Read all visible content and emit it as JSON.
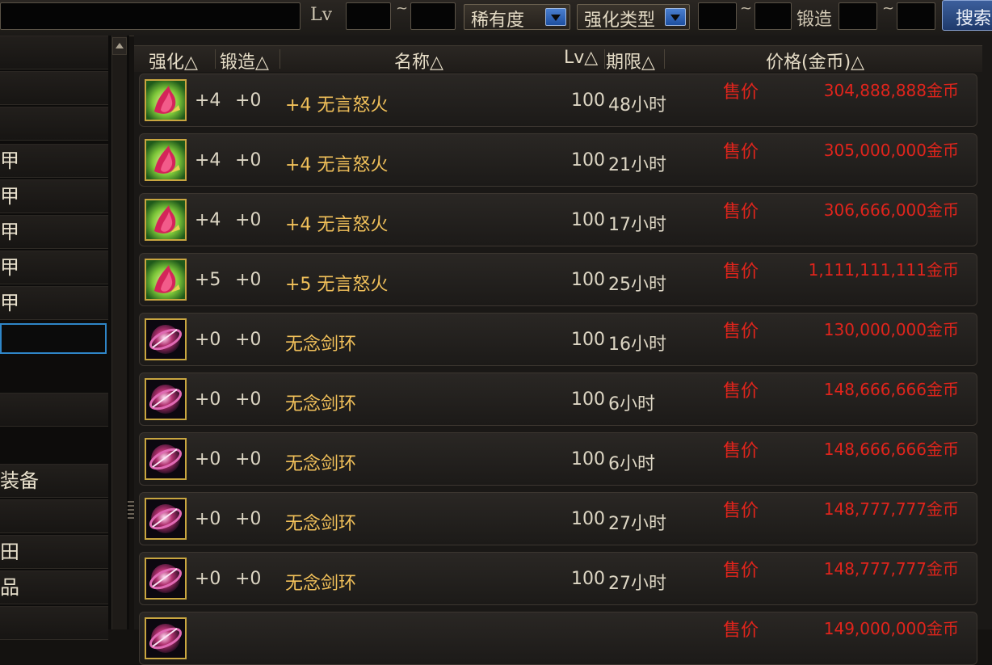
{
  "topbar": {
    "lv_label": "Lv",
    "tilde": "~",
    "rarity_label": "稀有度",
    "enhance_type_label": "强化类型",
    "forge_label": "锻造",
    "search_label": "搜索"
  },
  "sidebar": {
    "items": [
      {
        "label": ""
      },
      {
        "label": ""
      },
      {
        "label": ""
      },
      {
        "label": "甲"
      },
      {
        "label": "甲"
      },
      {
        "label": "甲"
      },
      {
        "label": "甲"
      },
      {
        "label": "甲"
      },
      {
        "label": ""
      },
      {
        "label": ""
      },
      {
        "label": ""
      },
      {
        "label": ""
      },
      {
        "label": "装备"
      },
      {
        "label": ""
      },
      {
        "label": "田"
      },
      {
        "label": "品"
      },
      {
        "label": ""
      }
    ]
  },
  "table": {
    "headers": {
      "enhance": "强化△",
      "forge": "锻造△",
      "name": "名称△",
      "lv": "Lv△",
      "expire": "期限△",
      "price": "价格(金币)△"
    },
    "sale_label": "售价",
    "rows": [
      {
        "icon": "flame-gem-icon",
        "enhance": "+4",
        "forge": "+0",
        "name": "+4 无言怒火",
        "lv": "100",
        "expire": "48小时",
        "price": "304,888,888金币"
      },
      {
        "icon": "flame-gem-icon",
        "enhance": "+4",
        "forge": "+0",
        "name": "+4 无言怒火",
        "lv": "100",
        "expire": "21小时",
        "price": "305,000,000金币"
      },
      {
        "icon": "flame-gem-icon",
        "enhance": "+4",
        "forge": "+0",
        "name": "+4 无言怒火",
        "lv": "100",
        "expire": "17小时",
        "price": "306,666,000金币"
      },
      {
        "icon": "flame-gem-icon",
        "enhance": "+5",
        "forge": "+0",
        "name": "+5 无言怒火",
        "lv": "100",
        "expire": "25小时",
        "price": "1,111,111,111金币"
      },
      {
        "icon": "sword-ring-icon",
        "enhance": "+0",
        "forge": "+0",
        "name": "无念剑环",
        "lv": "100",
        "expire": "16小时",
        "price": "130,000,000金币"
      },
      {
        "icon": "sword-ring-icon",
        "enhance": "+0",
        "forge": "+0",
        "name": "无念剑环",
        "lv": "100",
        "expire": "6小时",
        "price": "148,666,666金币"
      },
      {
        "icon": "sword-ring-icon",
        "enhance": "+0",
        "forge": "+0",
        "name": "无念剑环",
        "lv": "100",
        "expire": "6小时",
        "price": "148,666,666金币"
      },
      {
        "icon": "sword-ring-icon",
        "enhance": "+0",
        "forge": "+0",
        "name": "无念剑环",
        "lv": "100",
        "expire": "27小时",
        "price": "148,777,777金币"
      },
      {
        "icon": "sword-ring-icon",
        "enhance": "+0",
        "forge": "+0",
        "name": "无念剑环",
        "lv": "100",
        "expire": "27小时",
        "price": "148,777,777金币"
      },
      {
        "icon": "sword-ring-icon",
        "enhance": "",
        "forge": "",
        "name": "",
        "lv": "",
        "expire": "",
        "price": "149,000,000金币"
      }
    ]
  },
  "colors": {
    "price_red": "#e0241c",
    "name_gold": "#f2c15a",
    "selection_blue": "#2f86c8"
  }
}
